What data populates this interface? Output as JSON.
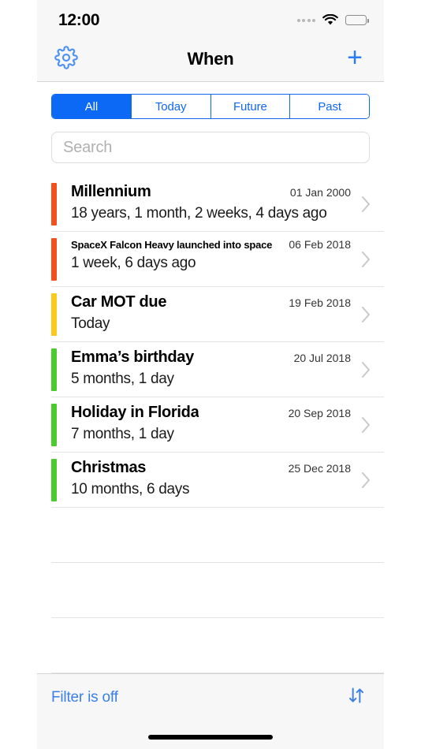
{
  "status_bar": {
    "time": "12:00",
    "cellular_icon": "cellular-dots-icon",
    "wifi_icon": "wifi-icon",
    "battery_icon": "battery-full-icon"
  },
  "nav": {
    "title": "When",
    "settings_icon": "gear-icon",
    "add_label": "+"
  },
  "segments": [
    {
      "label": "All",
      "active": true
    },
    {
      "label": "Today",
      "active": false
    },
    {
      "label": "Future",
      "active": false
    },
    {
      "label": "Past",
      "active": false
    }
  ],
  "search": {
    "placeholder": "Search",
    "value": ""
  },
  "events": [
    {
      "title": "Millennium",
      "date": "01 Jan 2000",
      "interval": "18 years, 1 month, 2 weeks, 4 days ago",
      "color": "#f4501e",
      "small_title": false
    },
    {
      "title": "SpaceX Falcon Heavy launched into space",
      "date": "06 Feb 2018",
      "interval": "1 week, 6 days ago",
      "color": "#f4501e",
      "small_title": true
    },
    {
      "title": "Car MOT due",
      "date": "19 Feb 2018",
      "interval": "Today",
      "color": "#fdc81c",
      "small_title": false
    },
    {
      "title": "Emma’s birthday",
      "date": "20 Jul 2018",
      "interval": "5 months, 1 day",
      "color": "#4acb2e",
      "small_title": false
    },
    {
      "title": "Holiday in Florida",
      "date": "20 Sep 2018",
      "interval": "7 months, 1 day",
      "color": "#4acb2e",
      "small_title": false
    },
    {
      "title": "Christmas",
      "date": "25 Dec 2018",
      "interval": "10 months, 6 days",
      "color": "#4acb2e",
      "small_title": false
    }
  ],
  "empty_rows": 3,
  "toolbar": {
    "filter_label": "Filter is off",
    "sort_icon": "sort-arrows-icon"
  },
  "colors": {
    "accent_blue": "#0b69f5",
    "link_blue": "#3b7fe8",
    "past_marker": "#f4501e",
    "today_marker": "#fdc81c",
    "future_marker": "#4acb2e",
    "chrome_bg": "#f7f7f7"
  }
}
